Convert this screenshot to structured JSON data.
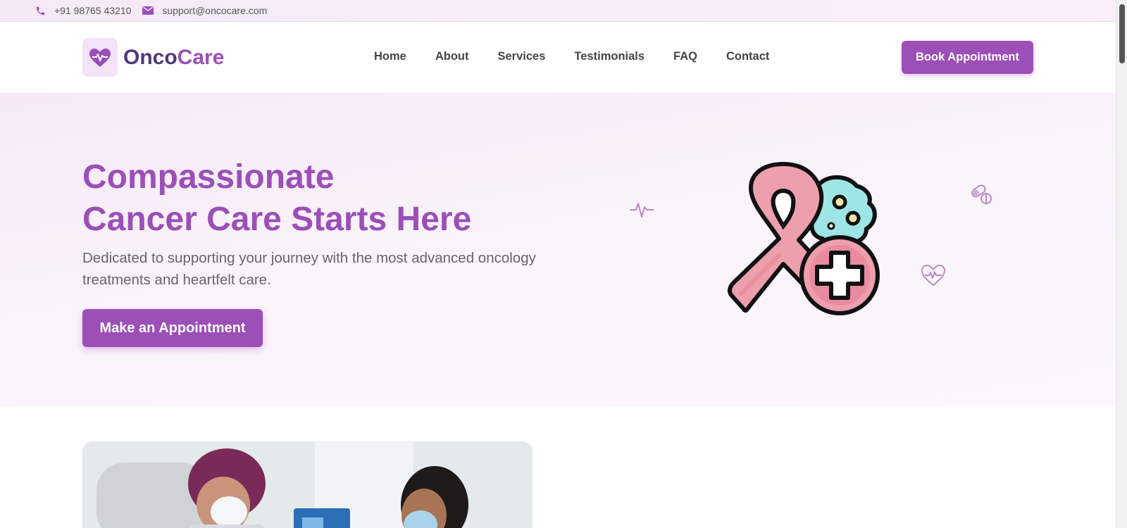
{
  "topbar": {
    "phone": "+91 98765 43210",
    "email": "support@oncocare.com"
  },
  "logo": {
    "part1": "Onco",
    "part2": "Care"
  },
  "nav": {
    "items": [
      "Home",
      "About",
      "Services",
      "Testimonials",
      "FAQ",
      "Contact"
    ],
    "book_label": "Book Appointment"
  },
  "hero": {
    "title_line1": "Compassionate",
    "title_line2": "Cancer Care Starts Here",
    "subtitle": "Dedicated to supporting your journey with the most advanced oncology treatments and heartfelt care.",
    "cta_label": "Make an Appointment"
  },
  "colors": {
    "accent": "#9b4fb7",
    "logo_dark": "#4c3a78",
    "ribbon": "#ee9fae",
    "cell": "#9ee5e5"
  },
  "icons": {
    "phone": "phone-icon",
    "email": "mail-icon",
    "logo": "heart-pulse-icon",
    "hero_art": "cancer-ribbon-icon"
  }
}
